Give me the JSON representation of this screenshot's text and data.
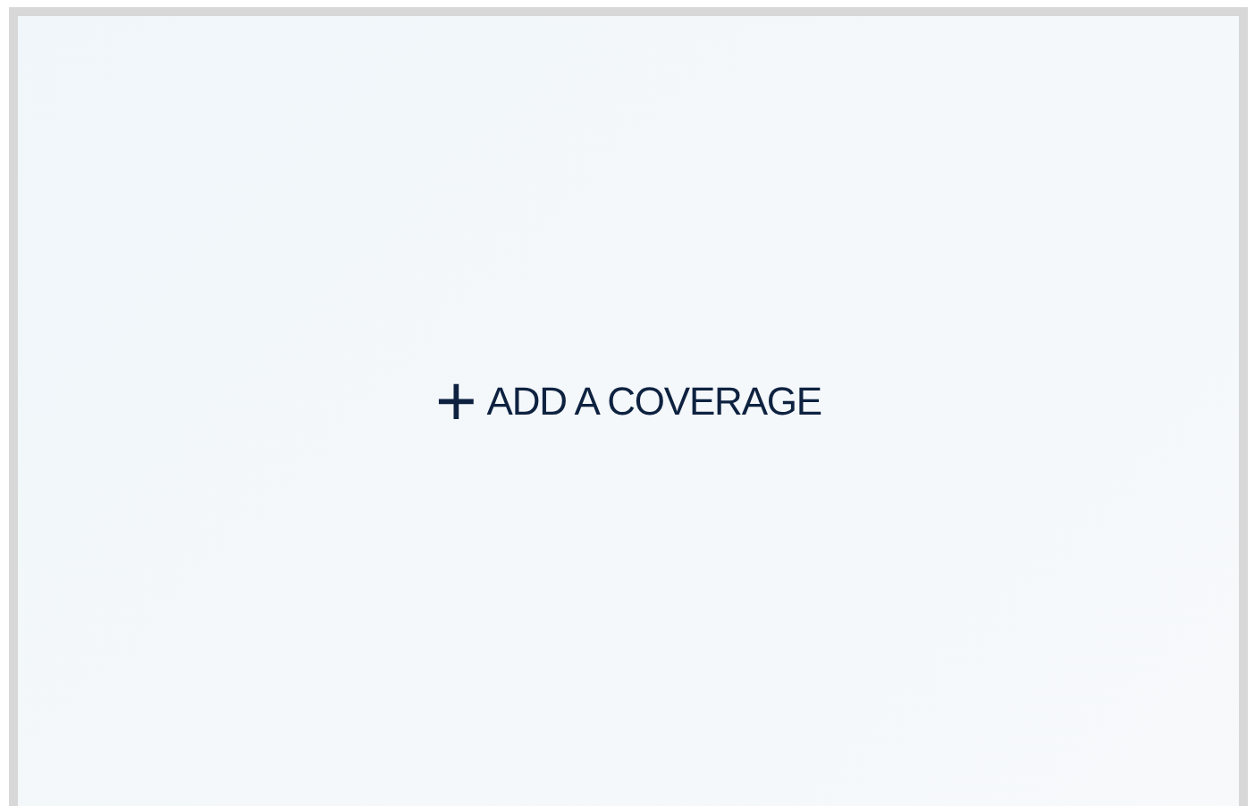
{
  "add_button": {
    "icon": "+",
    "label": "ADD A COVERAGE"
  }
}
